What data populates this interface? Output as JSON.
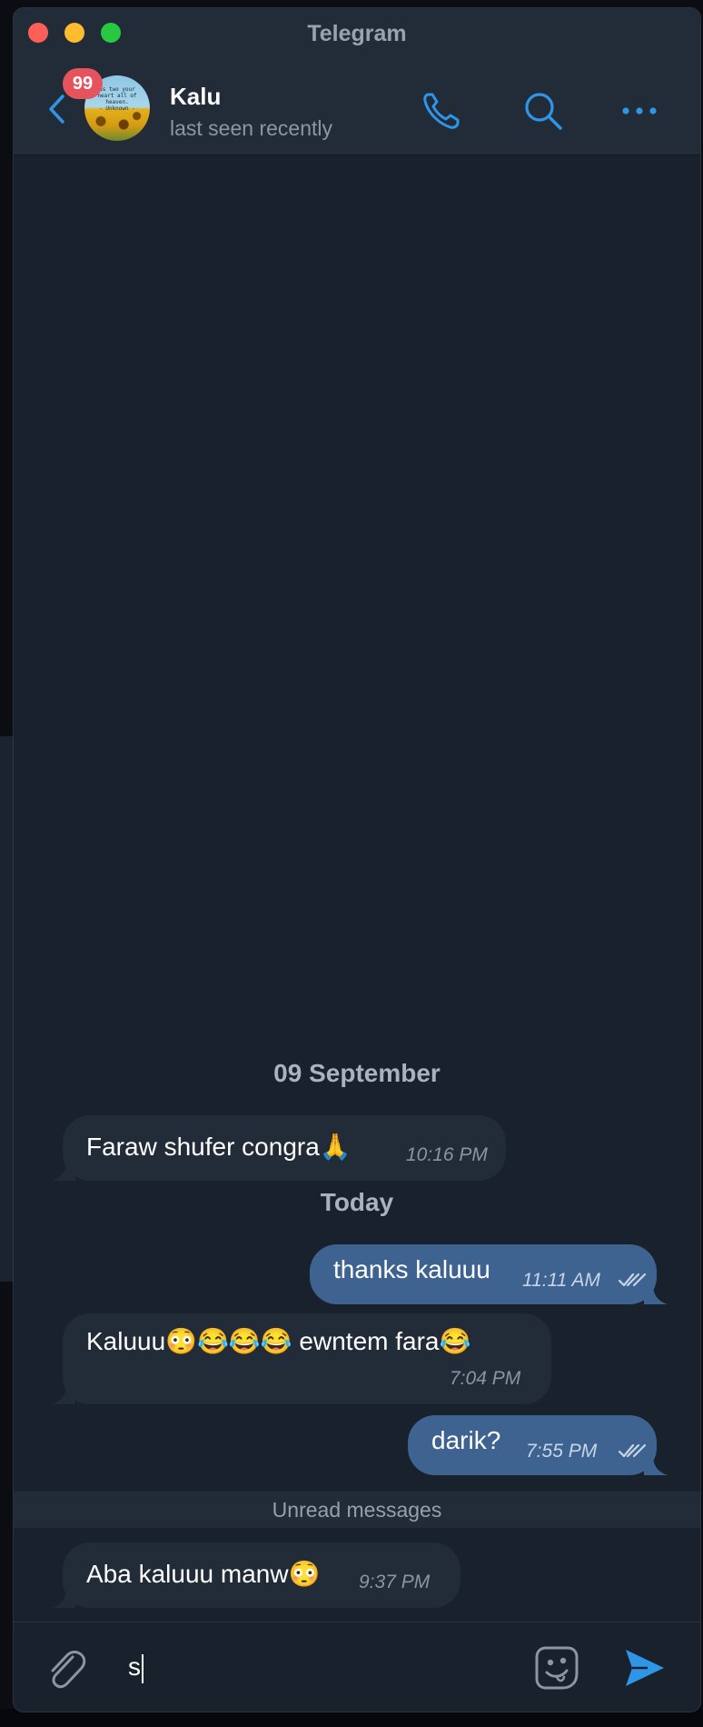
{
  "window": {
    "title": "Telegram"
  },
  "header": {
    "badge_count": "99",
    "contact_name": "Kalu",
    "contact_status": "last seen recently",
    "avatar_text": "as two your\nheart all of\nheaven.\n- Unknown -"
  },
  "messages": {
    "date_1": "09 September",
    "m1": {
      "text": "Faraw shufer congra🙏",
      "time": "10:16 PM",
      "direction": "incoming"
    },
    "date_2": "Today",
    "m2": {
      "text": "thanks kaluuu",
      "time": "11:11 AM",
      "direction": "outgoing",
      "status": "read"
    },
    "m3": {
      "text": "Kaluuu😳😂😂😂 ewntem fara😂",
      "time": "7:04 PM",
      "direction": "incoming"
    },
    "m4": {
      "text": "darik?",
      "time": "7:55 PM",
      "direction": "outgoing",
      "status": "read"
    },
    "unread_label": "Unread messages",
    "m5": {
      "text": "Aba kaluuu manw😳",
      "time": "9:37 PM",
      "direction": "incoming"
    }
  },
  "composer": {
    "input_value": "s"
  },
  "colors": {
    "accent": "#2f95e6",
    "incoming_bubble": "#222c39",
    "outgoing_bubble": "#3e6390",
    "badge": "#e5535c",
    "chat_background": "#18212c"
  },
  "icons": [
    "back-icon",
    "phone-icon",
    "search-icon",
    "more-icon",
    "attachment-icon",
    "sticker-icon",
    "send-icon",
    "double-check-icon"
  ]
}
